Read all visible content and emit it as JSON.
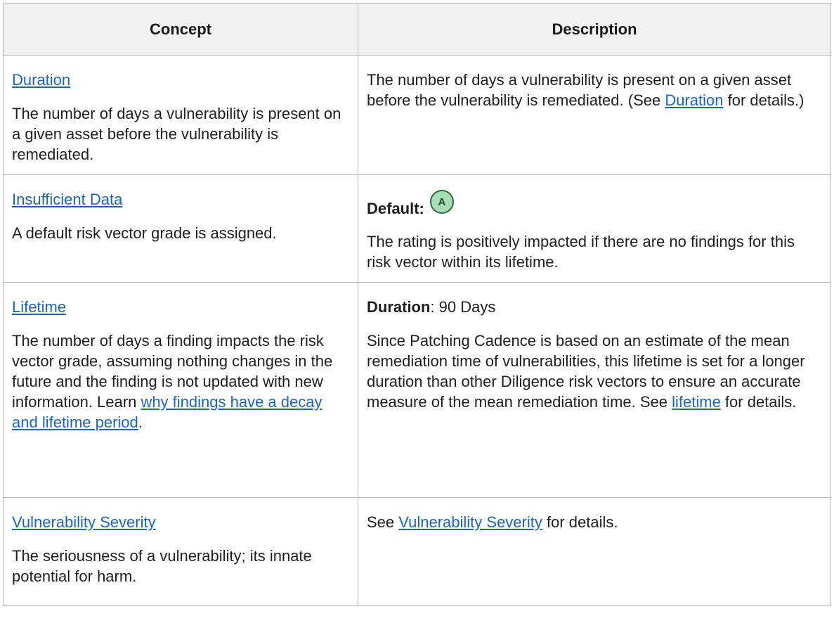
{
  "headers": {
    "concept": "Concept",
    "description": "Description"
  },
  "rows": {
    "duration": {
      "concept_link": "Duration",
      "concept_text": "The number of days a vulnerability is present on a given asset before the vulnerability is remediated.",
      "desc_text_before": "The number of days a vulnerability is present on a given asset before the vulnerability is remediated. (See ",
      "desc_link": "Duration",
      "desc_text_after": " for details.)"
    },
    "insufficient": {
      "concept_link": "Insufficient Data",
      "concept_text": "A default risk vector grade is assigned.",
      "default_label": "Default:",
      "grade": "A",
      "desc_text": "The rating is positively impacted if there are no findings for this risk vector within its lifetime."
    },
    "lifetime": {
      "concept_link": "Lifetime",
      "concept_text_before": "The number of days a finding impacts the risk vector grade, assuming nothing changes in the future and the finding is not updated with new information. Learn ",
      "concept_inline_link": "why findings have a decay and lifetime period",
      "concept_text_after": ".",
      "duration_label": "Duration",
      "duration_value": ": 90 Days",
      "desc_text_before": "Since Patching Cadence is based on an estimate of the mean remediation time of vulnerabilities, this lifetime is set for a longer duration than other Diligence risk vectors to ensure an accurate measure of the mean remediation time. See ",
      "desc_link": "lifetime",
      "desc_text_after": " for details."
    },
    "vuln_severity": {
      "concept_link": "Vulnerability Severity",
      "concept_text": "The seriousness of a vulnerability; its innate potential for harm.",
      "desc_text_before": "See ",
      "desc_link": "Vulnerability Severity",
      "desc_text_after": " for details."
    }
  },
  "colors": {
    "link": "#1a64c7",
    "header_bg": "#f1f1f1",
    "border": "#b8b8b8",
    "grade_a_bg": "#a9dcb7",
    "grade_a_border": "#2d6b3f"
  }
}
